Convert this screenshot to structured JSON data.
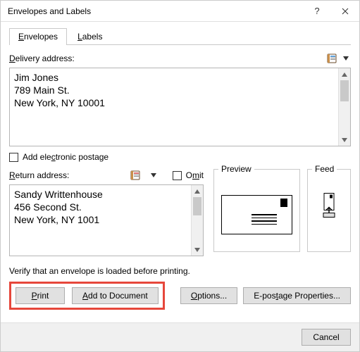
{
  "window": {
    "title": "Envelopes and Labels"
  },
  "tabs": {
    "envelopes": "Envelopes",
    "labels": "Labels"
  },
  "delivery": {
    "label_pre": "D",
    "label_rest": "elivery address:",
    "value": "Jim Jones\n789 Main St.\nNew York, NY 10001"
  },
  "electronic_postage": {
    "label_pre": "Add ele",
    "label_u": "c",
    "label_post": "tronic postage"
  },
  "return": {
    "label_u": "R",
    "label_rest": "eturn address:",
    "value": "Sandy Writtenhouse\n456 Second St.\nNew York, NY 1001"
  },
  "omit": {
    "label_pre": "O",
    "label_u": "m",
    "label_post": "it"
  },
  "preview": {
    "legend": "Preview"
  },
  "feed": {
    "legend": "Feed"
  },
  "verify": "Verify that an envelope is loaded before printing.",
  "buttons": {
    "print_u": "P",
    "print_rest": "rint",
    "add_u": "A",
    "add_rest": "dd to Document",
    "options_u": "O",
    "options_rest": "ptions...",
    "epostage_pre": "E-pos",
    "epostage_u": "t",
    "epostage_post": "age Properties...",
    "cancel": "Cancel"
  }
}
